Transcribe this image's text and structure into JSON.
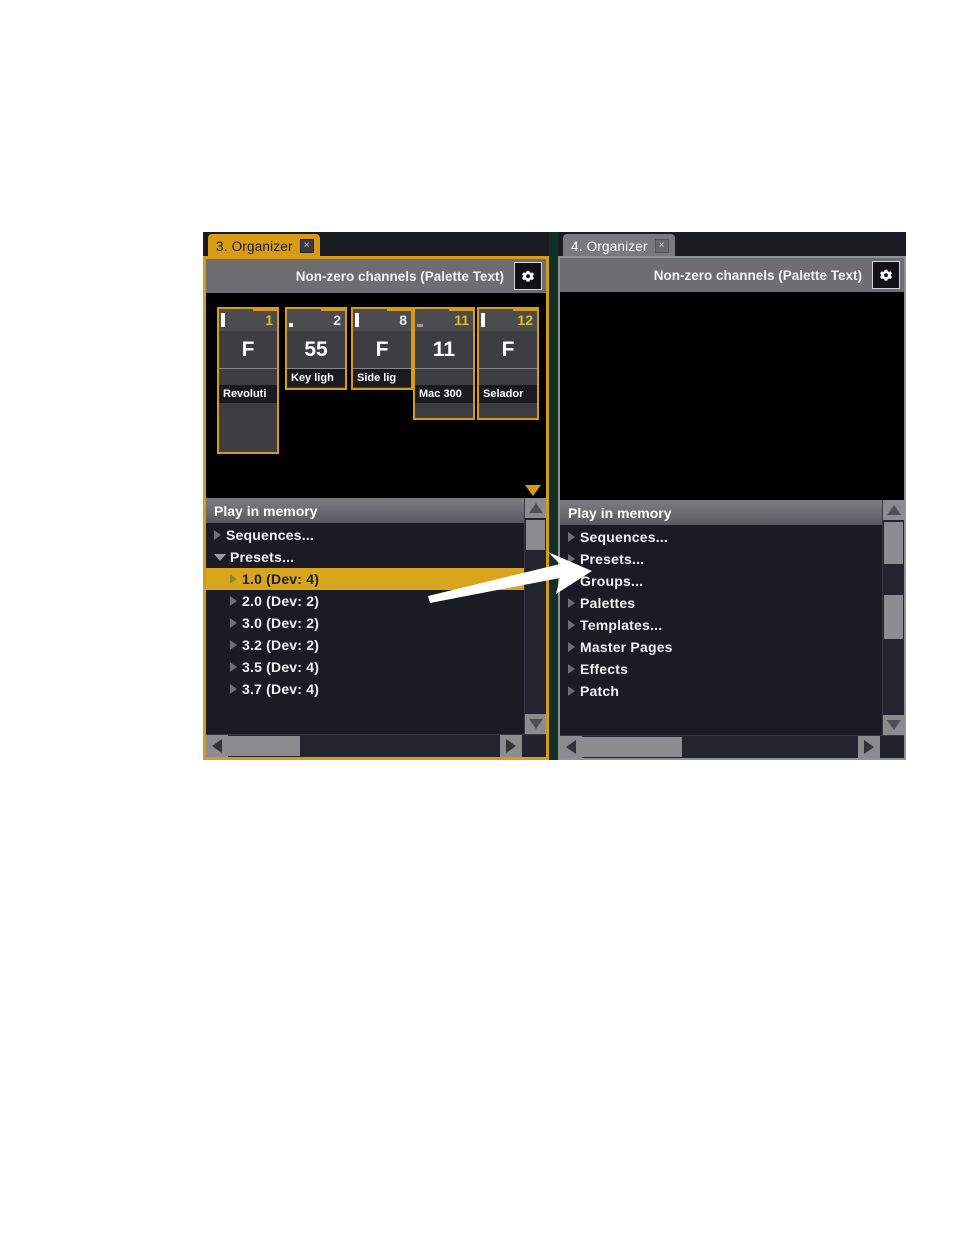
{
  "windows": [
    {
      "id": "left",
      "tab": {
        "label": "3. Organizer",
        "close_icon": "close-icon",
        "close_glyph": "×",
        "state": "active"
      },
      "pane_header": {
        "title": "Non-zero channels (Palette Text)",
        "gear_icon": "gear-icon"
      },
      "tiles": [
        {
          "number": "1",
          "number_color": "yellow",
          "value": "F",
          "name": "Revoluti",
          "mark": "full",
          "tall": true
        },
        {
          "number": "2",
          "number_color": "white",
          "value": "55",
          "name": "Key ligh",
          "mark": "low",
          "tall": false
        },
        {
          "number": "8",
          "number_color": "white",
          "value": "F",
          "name": "Side lig",
          "mark": "full",
          "tall": false
        },
        {
          "number": "11",
          "number_color": "yellow",
          "value": "11",
          "name": "Mac 300",
          "mark": "dash",
          "tall": true
        },
        {
          "number": "12",
          "number_color": "yellow",
          "value": "F",
          "name": "Selador",
          "mark": "full",
          "tall": true
        }
      ],
      "tile_overflow_icon": "scroll-down-triangle-icon",
      "list": {
        "title": "Play in memory",
        "items": [
          {
            "label": "Sequences...",
            "level": 0,
            "expander": "right",
            "selected": false
          },
          {
            "label": "Presets...",
            "level": 0,
            "expander": "down",
            "selected": false
          },
          {
            "label": "1.0  (Dev: 4)",
            "level": 1,
            "expander": "right",
            "selected": true
          },
          {
            "label": "2.0  (Dev: 2)",
            "level": 1,
            "expander": "right",
            "selected": false
          },
          {
            "label": "3.0  (Dev: 2)",
            "level": 1,
            "expander": "right",
            "selected": false
          },
          {
            "label": "3.2  (Dev: 2)",
            "level": 1,
            "expander": "right",
            "selected": false
          },
          {
            "label": "3.5  (Dev: 4)",
            "level": 1,
            "expander": "right",
            "selected": false
          },
          {
            "label": "3.7  (Dev: 4)",
            "level": 1,
            "expander": "right",
            "selected": false
          }
        ]
      }
    },
    {
      "id": "right",
      "tab": {
        "label": "4. Organizer",
        "close_icon": "close-icon",
        "close_glyph": "×",
        "state": "inactive"
      },
      "pane_header": {
        "title": "Non-zero channels (Palette Text)",
        "gear_icon": "gear-icon"
      },
      "tiles": [],
      "tile_overflow_icon": "",
      "list": {
        "title": "Play in memory",
        "items": [
          {
            "label": "Sequences...",
            "level": 0,
            "expander": "right",
            "selected": false
          },
          {
            "label": "Presets...",
            "level": 0,
            "expander": "right",
            "selected": false
          },
          {
            "label": "Groups...",
            "level": 0,
            "expander": "right",
            "selected": false
          },
          {
            "label": "Palettes",
            "level": 0,
            "expander": "right",
            "selected": false
          },
          {
            "label": "Templates...",
            "level": 0,
            "expander": "right",
            "selected": false
          },
          {
            "label": "Master Pages",
            "level": 0,
            "expander": "right",
            "selected": false
          },
          {
            "label": "Effects",
            "level": 0,
            "expander": "right",
            "selected": false
          },
          {
            "label": "Patch",
            "level": 0,
            "expander": "right",
            "selected": false
          }
        ]
      }
    }
  ],
  "annotation": {
    "name": "pointer-arrow",
    "color": "#ffffff"
  },
  "colors": {
    "accent": "#d89b18",
    "selection": "#d8a51e",
    "backdrop": "#113122",
    "panel_bg": "#1b1b24",
    "header_gray": "#6e6e72",
    "tile_bg": "#3d3d42"
  }
}
